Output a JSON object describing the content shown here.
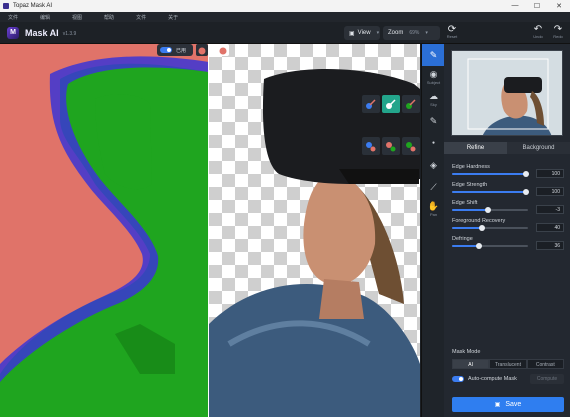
{
  "window": {
    "title": "Topaz Mask AI",
    "controls": [
      "—",
      "☐",
      "✕"
    ]
  },
  "menu": {
    "items": [
      "文件",
      "编辑",
      "视图",
      "帮助",
      "文件",
      "关于"
    ]
  },
  "app": {
    "name": "Mask AI",
    "version": "v1.3.9"
  },
  "toolbar": {
    "view_label": "View",
    "view_value": "▾",
    "zoom_label": "Zoom",
    "zoom_value": "69%",
    "reset_label": "Reset",
    "undo_label": "Undo",
    "redo_label": "Redo"
  },
  "canvas": {
    "toggle_label": "已用"
  },
  "tools": [
    {
      "icon": "brush",
      "label": ""
    },
    {
      "icon": "subject",
      "label": "Subject"
    },
    {
      "icon": "sky",
      "label": "Sky"
    },
    {
      "icon": "brush",
      "label": ""
    },
    {
      "icon": "dot",
      "label": ""
    },
    {
      "icon": "fill",
      "label": ""
    },
    {
      "icon": "picker",
      "label": ""
    },
    {
      "icon": "hand",
      "label": "Pan"
    }
  ],
  "panel": {
    "tabs": [
      "Refine",
      "Background"
    ],
    "sliders": [
      {
        "label": "Edge Hardness",
        "value": "100",
        "fraction": 0.97
      },
      {
        "label": "Edge Strength",
        "value": "100",
        "fraction": 0.97
      },
      {
        "label": "Edge Shift",
        "value": "-3",
        "fraction": 0.48
      },
      {
        "label": "Foreground Recovery",
        "value": "40",
        "fraction": 0.4
      },
      {
        "label": "Defringe",
        "value": "36",
        "fraction": 0.36
      }
    ],
    "mask_mode_label": "Mask Mode",
    "mask_modes": [
      "AI",
      "Translucent",
      "Contrast"
    ],
    "auto_compute_label": "Auto-compute Mask",
    "compute_label": "Compute",
    "save_label": "Save"
  },
  "colors": {
    "accent": "#2f7ef0",
    "keep": "#1fa51f",
    "cut": "#e07369",
    "edge": "#3b35d6",
    "selected_tool": "#23a58b"
  }
}
